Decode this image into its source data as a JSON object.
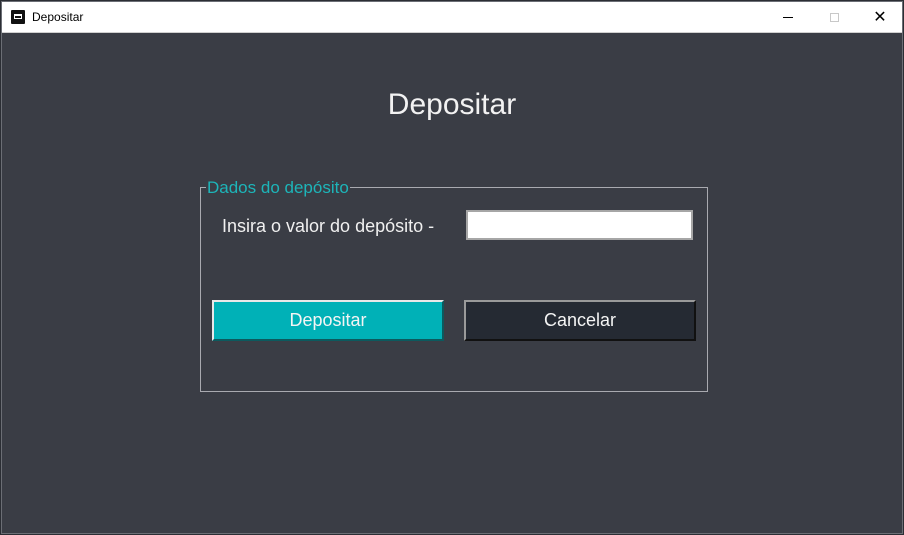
{
  "window": {
    "title": "Depositar"
  },
  "main": {
    "heading": "Depositar"
  },
  "group": {
    "legend": "Dados do depósito",
    "field_label": "Insira o valor do depósito -",
    "amount_value": "",
    "amount_placeholder": ""
  },
  "buttons": {
    "deposit_label": "Depositar",
    "cancel_label": "Cancelar"
  },
  "colors": {
    "accent": "#00b1b7",
    "background": "#3a3d45",
    "cancel_button": "#252a33",
    "legend_text": "#1db5b9"
  }
}
